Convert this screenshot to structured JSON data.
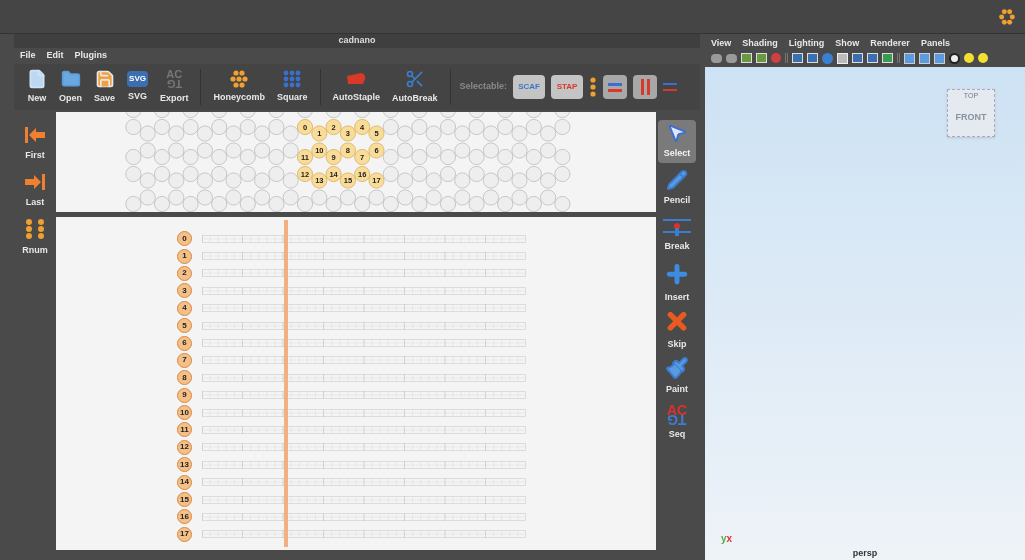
{
  "window": {
    "title": "cadnano"
  },
  "menu": [
    "File",
    "Edit",
    "Plugins"
  ],
  "toolbar": [
    {
      "kind": "new",
      "label": "New"
    },
    {
      "kind": "open",
      "label": "Open"
    },
    {
      "kind": "save",
      "label": "Save"
    },
    {
      "kind": "svg",
      "label": "SVG",
      "glyph": "SVG"
    },
    {
      "kind": "export",
      "label": "Export",
      "glyph_top": "AC",
      "glyph_bottom": "TG"
    },
    {
      "kind": "honeycomb",
      "label": "Honeycomb"
    },
    {
      "kind": "square",
      "label": "Square"
    },
    {
      "kind": "autostaple",
      "label": "AutoStaple"
    },
    {
      "kind": "autobreak",
      "label": "AutoBreak"
    }
  ],
  "selectable": {
    "label": "Selectable:",
    "filters": [
      {
        "label": "SCAF",
        "color": "#3a78c8"
      },
      {
        "label": "STAP",
        "color": "#d8392b"
      }
    ]
  },
  "sidebar": [
    {
      "kind": "first",
      "label": "First"
    },
    {
      "kind": "last",
      "label": "Last"
    },
    {
      "kind": "rnum",
      "label": "Rnum"
    }
  ],
  "slice_helices": [
    "0",
    "1",
    "2",
    "3",
    "4",
    "5",
    "6",
    "7",
    "8",
    "9",
    "10",
    "11",
    "12",
    "13",
    "14",
    "15",
    "16",
    "17"
  ],
  "path_helices": [
    "0",
    "1",
    "2",
    "3",
    "4",
    "5",
    "6",
    "7",
    "8",
    "9",
    "10",
    "11",
    "12",
    "13",
    "14",
    "15",
    "16",
    "17"
  ],
  "tools": [
    {
      "kind": "select",
      "label": "Select",
      "selected": true
    },
    {
      "kind": "pencil",
      "label": "Pencil",
      "selected": false
    },
    {
      "kind": "break",
      "label": "Break",
      "selected": false
    },
    {
      "kind": "insert",
      "label": "Insert",
      "selected": false
    },
    {
      "kind": "skip",
      "label": "Skip",
      "selected": false
    },
    {
      "kind": "paint",
      "label": "Paint",
      "selected": false
    },
    {
      "kind": "seq",
      "label": "Seq",
      "selected": false,
      "glyph_top": "AC",
      "glyph_bottom": "TG"
    }
  ],
  "viewport": {
    "menu": [
      "View",
      "Shading",
      "Lighting",
      "Show",
      "Renderer",
      "Panels"
    ],
    "cube_top": "TOP",
    "cube_front": "FRONT",
    "axis_y": "y",
    "axis_x": "x",
    "camera": "persp"
  }
}
